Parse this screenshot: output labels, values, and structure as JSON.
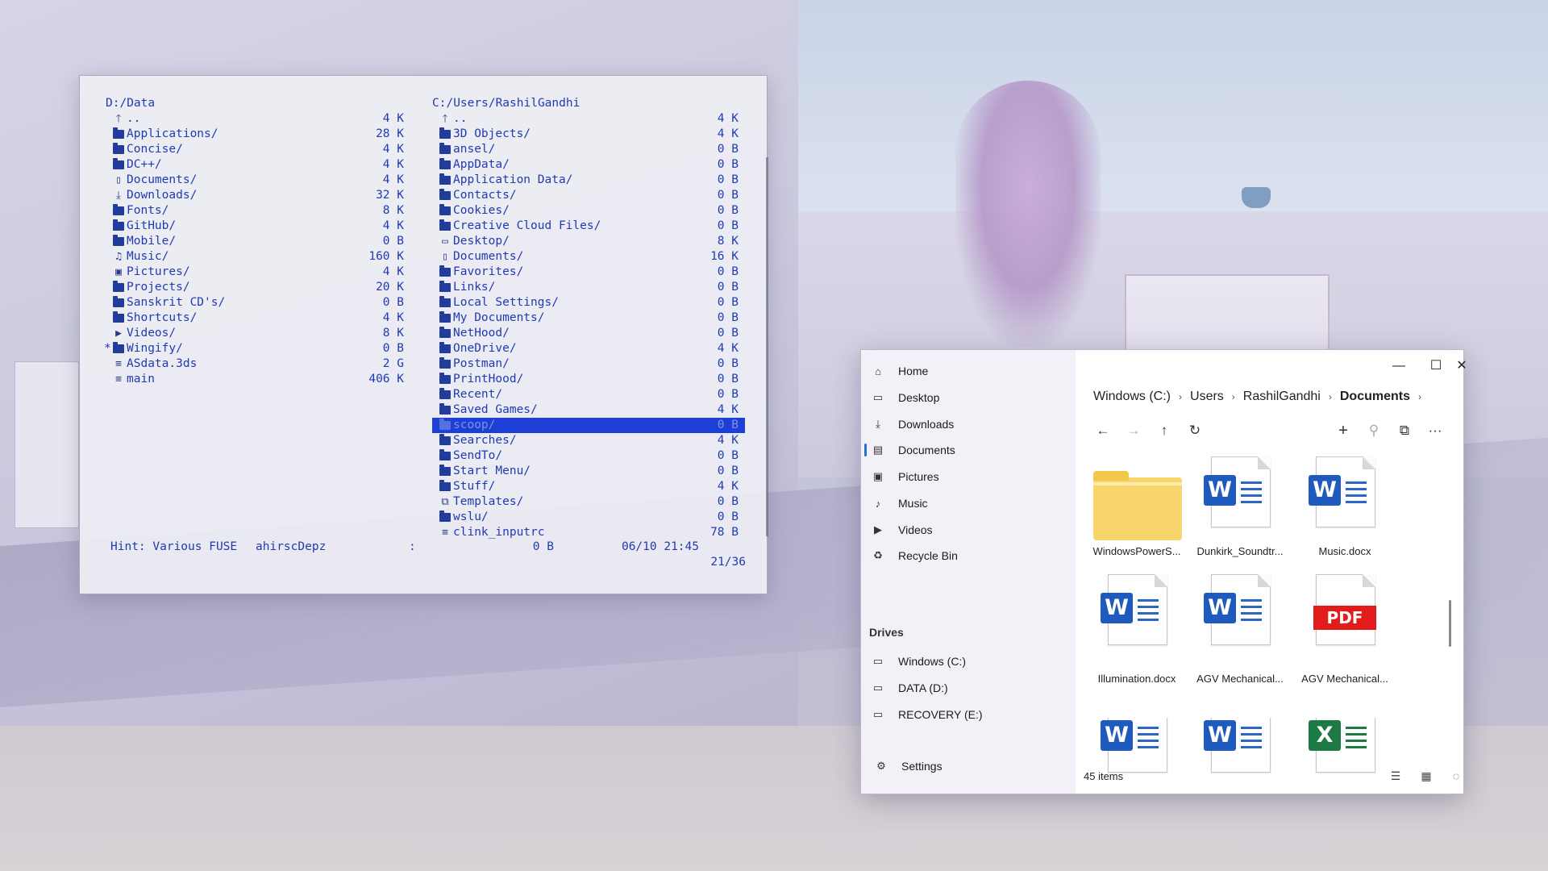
{
  "terminal": {
    "left": {
      "path": "D:/Data",
      "rows": [
        {
          "icon": "up",
          "name": "..",
          "size": "4 K"
        },
        {
          "icon": "folder",
          "name": "Applications/",
          "size": "28 K"
        },
        {
          "icon": "folder",
          "name": "Concise/",
          "size": "4 K"
        },
        {
          "icon": "folder",
          "name": "DC++/",
          "size": "4 K"
        },
        {
          "icon": "doc",
          "name": "Documents/",
          "size": "4 K"
        },
        {
          "icon": "download",
          "name": "Downloads/",
          "size": "32 K"
        },
        {
          "icon": "folder",
          "name": "Fonts/",
          "size": "8 K"
        },
        {
          "icon": "folder",
          "name": "GitHub/",
          "size": "4 K"
        },
        {
          "icon": "folder",
          "name": "Mobile/",
          "size": "0 B"
        },
        {
          "icon": "music",
          "name": "Music/",
          "size": "160 K"
        },
        {
          "icon": "picture",
          "name": "Pictures/",
          "size": "4 K"
        },
        {
          "icon": "folder",
          "name": "Projects/",
          "size": "20 K"
        },
        {
          "icon": "folder",
          "name": "Sanskrit CD's/",
          "size": "0 B"
        },
        {
          "icon": "folder",
          "name": "Shortcuts/",
          "size": "4 K"
        },
        {
          "icon": "video",
          "name": "Videos/",
          "size": "8 K"
        },
        {
          "icon": "folder",
          "name": "Wingify/",
          "size": "0 B",
          "mark": "*"
        },
        {
          "icon": "file",
          "name": "ASdata.3ds",
          "size": "2 G"
        },
        {
          "icon": "file",
          "name": "main",
          "size": "406 K"
        }
      ]
    },
    "right": {
      "path": "C:/Users/RashilGandhi",
      "rows": [
        {
          "icon": "up",
          "name": "..",
          "size": "4 K"
        },
        {
          "icon": "folder",
          "name": "3D Objects/",
          "size": "4 K"
        },
        {
          "icon": "folder",
          "name": "ansel/",
          "size": "0 B"
        },
        {
          "icon": "folder",
          "name": "AppData/",
          "size": "0 B"
        },
        {
          "icon": "folder",
          "name": "Application Data/",
          "size": "0 B"
        },
        {
          "icon": "folder",
          "name": "Contacts/",
          "size": "0 B"
        },
        {
          "icon": "folder",
          "name": "Cookies/",
          "size": "0 B"
        },
        {
          "icon": "folder",
          "name": "Creative Cloud Files/",
          "size": "0 B"
        },
        {
          "icon": "desktop",
          "name": "Desktop/",
          "size": "8 K"
        },
        {
          "icon": "doc",
          "name": "Documents/",
          "size": "16 K"
        },
        {
          "icon": "folder",
          "name": "Favorites/",
          "size": "0 B"
        },
        {
          "icon": "folder",
          "name": "Links/",
          "size": "0 B"
        },
        {
          "icon": "folder",
          "name": "Local Settings/",
          "size": "0 B"
        },
        {
          "icon": "folder",
          "name": "My Documents/",
          "size": "0 B"
        },
        {
          "icon": "folder",
          "name": "NetHood/",
          "size": "0 B"
        },
        {
          "icon": "folder",
          "name": "OneDrive/",
          "size": "4 K"
        },
        {
          "icon": "folder",
          "name": "Postman/",
          "size": "0 B"
        },
        {
          "icon": "folder",
          "name": "PrintHood/",
          "size": "0 B"
        },
        {
          "icon": "folder",
          "name": "Recent/",
          "size": "0 B"
        },
        {
          "icon": "folder",
          "name": "Saved Games/",
          "size": "4 K"
        },
        {
          "icon": "folder",
          "name": "scoop/",
          "size": "0 B",
          "selected": true
        },
        {
          "icon": "folder",
          "name": "Searches/",
          "size": "4 K"
        },
        {
          "icon": "folder",
          "name": "SendTo/",
          "size": "0 B"
        },
        {
          "icon": "folder",
          "name": "Start Menu/",
          "size": "0 B"
        },
        {
          "icon": "folder",
          "name": "Stuff/",
          "size": "4 K"
        },
        {
          "icon": "template",
          "name": "Templates/",
          "size": "0 B"
        },
        {
          "icon": "folder",
          "name": "wslu/",
          "size": "0 B"
        },
        {
          "icon": "file",
          "name": "clink_inputrc",
          "size": "78 B"
        }
      ]
    },
    "status": {
      "hint": "Hint: Various FUSE",
      "user": "ahirscDepz",
      "colon": ":",
      "size": "0 B",
      "datetime": "06/10 21:45",
      "count": "21/36"
    }
  },
  "explorer": {
    "nav": [
      {
        "icon": "home-icon",
        "glyph": "⌂",
        "label": "Home"
      },
      {
        "icon": "desktop-icon",
        "glyph": "▭",
        "label": "Desktop"
      },
      {
        "icon": "download-icon",
        "glyph": "⤓",
        "label": "Downloads"
      },
      {
        "icon": "document-icon",
        "glyph": "▤",
        "label": "Documents",
        "active": true
      },
      {
        "icon": "pictures-icon",
        "glyph": "▣",
        "label": "Pictures"
      },
      {
        "icon": "music-icon",
        "glyph": "♪",
        "label": "Music"
      },
      {
        "icon": "videos-icon",
        "glyph": "▶",
        "label": "Videos"
      },
      {
        "icon": "recycle-bin-icon",
        "glyph": "♻",
        "label": "Recycle Bin"
      }
    ],
    "drives_header": "Drives",
    "drives": [
      {
        "icon": "drive-icon",
        "glyph": "▭",
        "label": "Windows (C:)"
      },
      {
        "icon": "drive-icon",
        "glyph": "▭",
        "label": "DATA (D:)"
      },
      {
        "icon": "drive-icon",
        "glyph": "▭",
        "label": "RECOVERY (E:)"
      }
    ],
    "settings": {
      "glyph": "⚙",
      "label": "Settings"
    },
    "window_controls": {
      "minimize": "—",
      "maximize": "☐",
      "close": "✕"
    },
    "breadcrumb": [
      "Windows (C:)",
      "Users",
      "RashilGandhi",
      "Documents"
    ],
    "breadcrumb_sep": "›",
    "toolbar": {
      "back": "←",
      "forward": "→",
      "up": "↑",
      "refresh": "↻",
      "new": "+",
      "search": "⚲",
      "view": "⧉",
      "more": "···"
    },
    "items": [
      {
        "type": "folder",
        "name": "WindowsPowerS..."
      },
      {
        "type": "word",
        "name": "Dunkirk_Soundtr..."
      },
      {
        "type": "word",
        "name": "Music.docx"
      },
      {
        "type": "word",
        "name": "Illumination.docx"
      },
      {
        "type": "word",
        "name": "AGV Mechanical..."
      },
      {
        "type": "pdf",
        "name": "AGV Mechanical..."
      },
      {
        "type": "word",
        "name": ""
      },
      {
        "type": "word",
        "name": ""
      },
      {
        "type": "excel",
        "name": ""
      }
    ],
    "badges": {
      "word": "W",
      "excel": "X",
      "pdf": "PDF"
    },
    "status": "45 items",
    "status_icons": {
      "details": "☰",
      "layout": "▦",
      "loading": "◌"
    }
  }
}
